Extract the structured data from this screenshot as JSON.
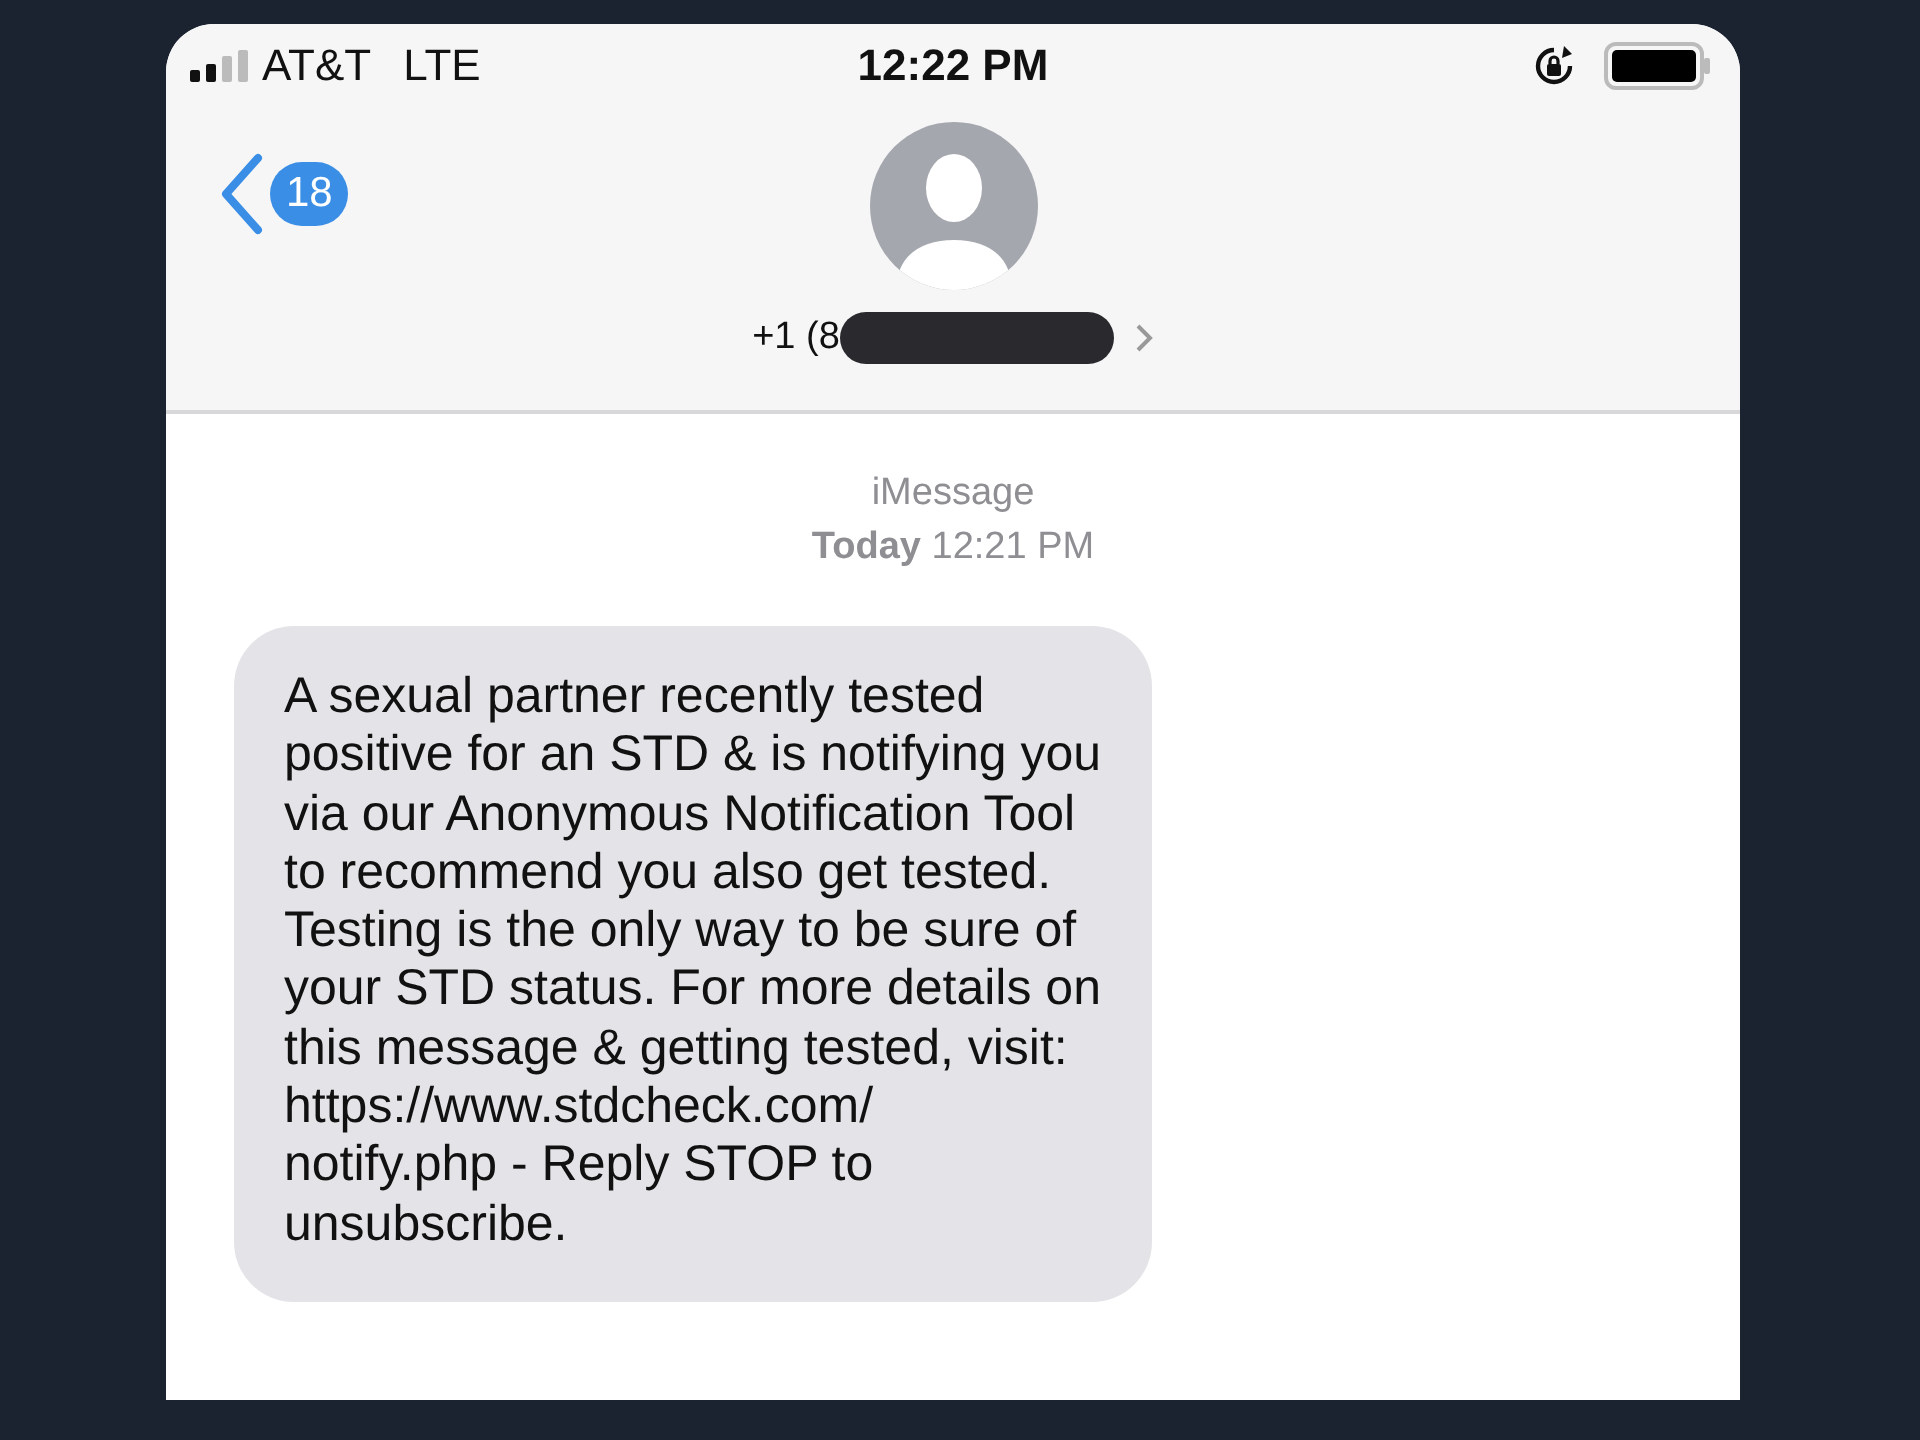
{
  "status_bar": {
    "carrier": "AT&T",
    "network": "LTE",
    "time": "12:22 PM"
  },
  "header": {
    "back_count": "18",
    "contact": "+1 (8"
  },
  "conversation": {
    "service": "iMessage",
    "timestamp_day": "Today",
    "timestamp_time": "12:21 PM",
    "messages": [
      {
        "kind": "incoming",
        "text": "A sexual partner recently tested\npositive for an STD & is notifying you\nvia our Anonymous Notification Tool\nto recommend you also get tested.\nTesting is the only way to be sure of\nyour STD status. For more details on\nthis message & getting tested, visit:\nhttps://www.stdcheck.com/\nnotify.php - Reply STOP to\nunsubscribe."
      }
    ]
  }
}
